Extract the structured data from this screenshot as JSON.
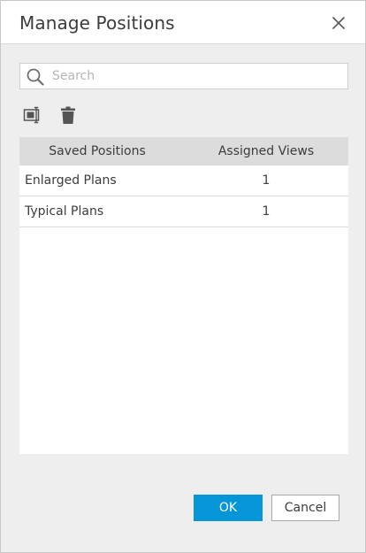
{
  "dialog": {
    "title": "Manage Positions",
    "close_icon": "close-icon"
  },
  "search": {
    "placeholder": "Search",
    "value": "",
    "icon": "search-icon"
  },
  "toolbar": {
    "icons": [
      "rename-position-icon",
      "delete-icon"
    ]
  },
  "table": {
    "columns": [
      "Saved Positions",
      "Assigned Views"
    ],
    "rows": [
      {
        "name": "Enlarged Plans",
        "views": "1"
      },
      {
        "name": "Typical Plans",
        "views": "1"
      }
    ]
  },
  "buttons": {
    "ok_label": "OK",
    "cancel_label": "Cancel"
  },
  "colors": {
    "accent": "#0696d7",
    "dialog_background": "#eeeeee",
    "header_row": "#dcdcdc",
    "text": "#3c3c3c",
    "icon": "#555555"
  }
}
